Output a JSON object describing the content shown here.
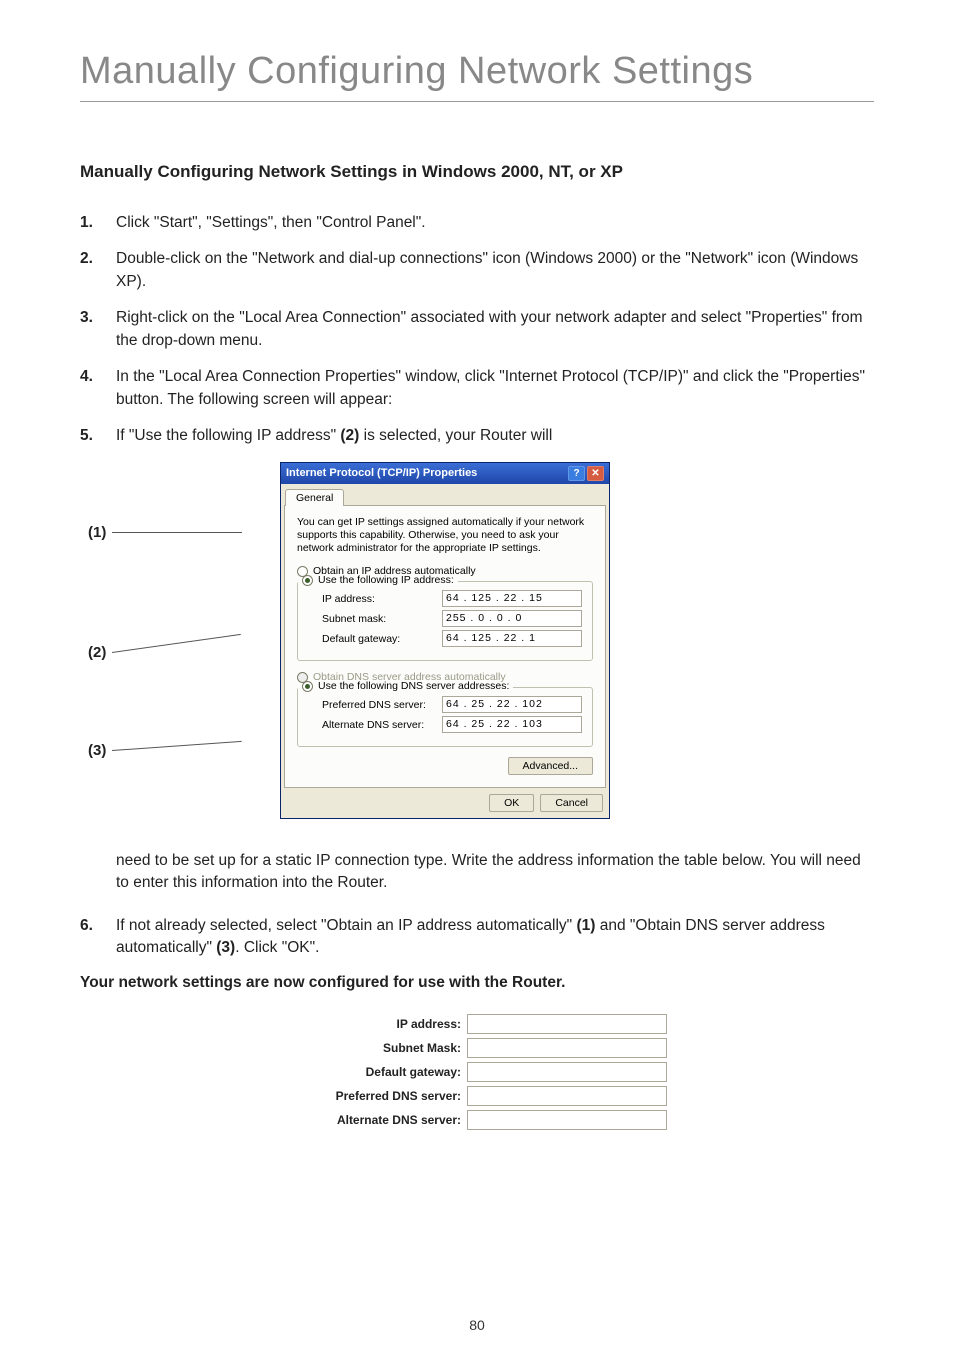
{
  "title": "Manually Configuring Network Settings",
  "section_heading": "Manually Configuring Network Settings in Windows 2000, NT, or XP",
  "steps": {
    "s1_num": "1.",
    "s1": "Click \"Start\", \"Settings\", then \"Control Panel\".",
    "s2_num": "2.",
    "s2": "Double-click on the \"Network and dial-up connections\" icon (Windows 2000) or the \"Network\" icon (Windows XP).",
    "s3_num": "3.",
    "s3": "Right-click on the \"Local Area Connection\" associated with your network adapter and select \"Properties\" from the drop-down menu.",
    "s4_num": "4.",
    "s4": "In the \"Local Area Connection Properties\" window, click \"Internet Protocol (TCP/IP)\" and click the \"Properties\" button. The following screen will appear:",
    "s5_num": "5.",
    "s5_a": "If \"Use the following IP address\" ",
    "s5_b": "(2)",
    "s5_c": " is selected, your Router will",
    "s5_after": "need to be set up for a static IP connection type. Write the address information the table below. You will need to enter this information into the Router.",
    "s6_num": "6.",
    "s6_a": "If not already selected, select \"Obtain an IP address automatically\" ",
    "s6_b": "(1)",
    "s6_c": " and \"Obtain DNS server address automatically\" ",
    "s6_d": "(3)",
    "s6_e": ". Click \"OK\"."
  },
  "footer_bold": "Your network settings are now configured for use with the Router.",
  "callouts": {
    "c1": "(1)",
    "c2": "(2)",
    "c3": "(3)"
  },
  "dialog": {
    "title": "Internet Protocol (TCP/IP) Properties",
    "help": "?",
    "close": "✕",
    "tab": "General",
    "desc": "You can get IP settings assigned automatically if your network supports this capability. Otherwise, you need to ask your network administrator for the appropriate IP settings.",
    "r_auto_ip": "Obtain an IP address automatically",
    "r_static_ip": "Use the following IP address:",
    "lbl_ip": "IP address:",
    "val_ip": "64 . 125 . 22 . 15",
    "lbl_mask": "Subnet mask:",
    "val_mask": "255 .  0  .  0  .  0",
    "lbl_gw": "Default gateway:",
    "val_gw": "64 . 125 . 22 .  1",
    "r_auto_dns": "Obtain DNS server address automatically",
    "r_static_dns": "Use the following DNS server addresses:",
    "lbl_pdns": "Preferred DNS server:",
    "val_pdns": "64 .  25 . 22 . 102",
    "lbl_adns": "Alternate DNS server:",
    "val_adns": "64 .  25 . 22 . 103",
    "btn_adv": "Advanced...",
    "btn_ok": "OK",
    "btn_cancel": "Cancel"
  },
  "mini": {
    "ip": "IP address:",
    "mask": "Subnet Mask:",
    "gw": "Default gateway:",
    "pdns": "Preferred DNS server:",
    "adns": "Alternate DNS server:"
  },
  "page_number": "80"
}
